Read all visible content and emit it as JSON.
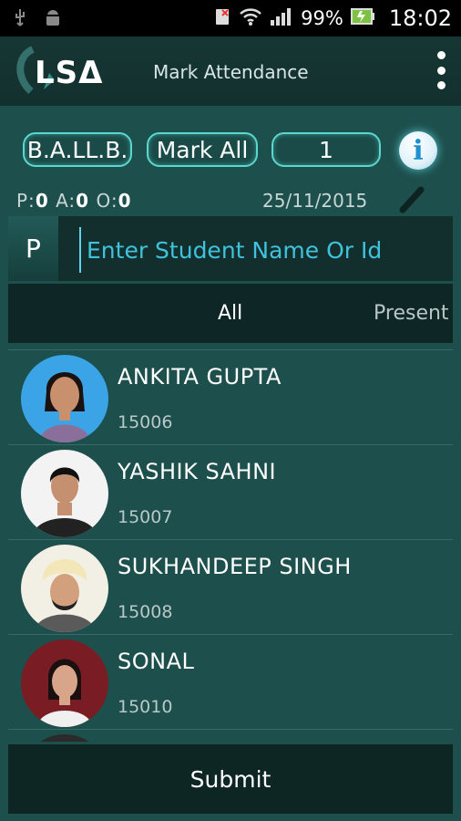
{
  "status_bar": {
    "battery": "99%",
    "time": "18:02"
  },
  "header": {
    "logo_text": "LSΔ",
    "title": "Mark Attendance"
  },
  "controls": {
    "course": "B.A.LL.B.",
    "mark_all": "Mark All",
    "section": "1",
    "info_icon": "i",
    "counts": {
      "p_label": "P:",
      "p": "0",
      "a_label": "A:",
      "a": "0",
      "o_label": "O:",
      "o": "0"
    },
    "date": "25/11/2015"
  },
  "search": {
    "prefix": "P",
    "placeholder": "Enter Student Name Or Id"
  },
  "tabs": [
    {
      "label": "All"
    },
    {
      "label": "Present"
    }
  ],
  "students": [
    {
      "name": "ANKITA GUPTA",
      "id": "15006"
    },
    {
      "name": "YASHIK SAHNI",
      "id": "15007"
    },
    {
      "name": "SUKHANDEEP SINGH",
      "id": "15008"
    },
    {
      "name": "SONAL",
      "id": "15010"
    }
  ],
  "footer": {
    "submit_label": "Submit"
  },
  "colors": {
    "accent": "#5ad7cf",
    "background": "#1d4f4c",
    "placeholder": "#3fc2dc"
  }
}
